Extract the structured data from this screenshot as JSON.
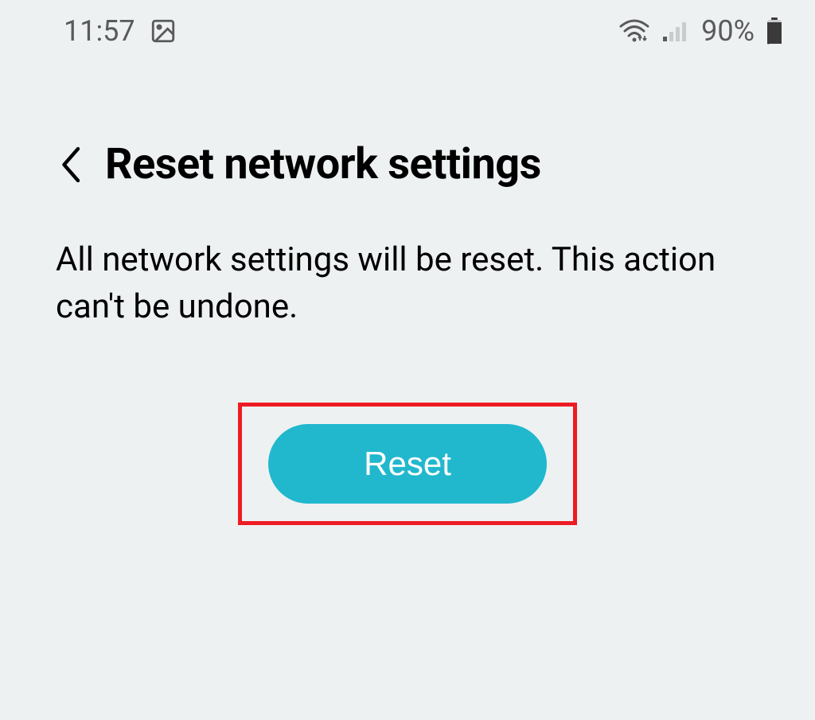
{
  "status_bar": {
    "time": "11:57",
    "battery_percentage": "90%"
  },
  "header": {
    "title": "Reset network settings"
  },
  "body": {
    "description": "All network settings will be reset. This action can't be undone."
  },
  "action": {
    "reset_label": "Reset"
  },
  "colors": {
    "background": "#eef1f2",
    "accent": "#21b8ce",
    "highlight_border": "#ed1c24"
  }
}
